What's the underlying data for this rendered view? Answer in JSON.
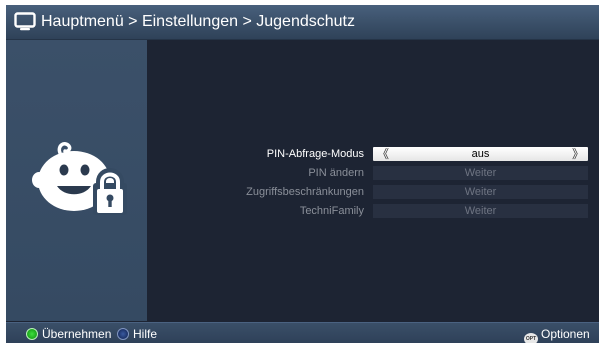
{
  "header": {
    "breadcrumb": "Hauptmenü > Einstellungen > Jugendschutz",
    "icon": "tv-icon"
  },
  "side_panel": {
    "icon": "child-lock-icon"
  },
  "menu": {
    "items": [
      {
        "label": "PIN-Abfrage-Modus",
        "value": "aus",
        "state": "active"
      },
      {
        "label": "PIN ändern",
        "value": "Weiter",
        "state": "disabled"
      },
      {
        "label": "Zugriffsbeschränkungen",
        "value": "Weiter",
        "state": "disabled"
      },
      {
        "label": "TechniFamily",
        "value": "Weiter",
        "state": "disabled"
      }
    ],
    "arrow_left": "《",
    "arrow_right": "》"
  },
  "footer": {
    "green_label": "Übernehmen",
    "blue_label": "Hilfe",
    "opt_badge": "OPT",
    "options_label": "Optionen"
  },
  "colors": {
    "background": "#1d2433",
    "header": "#3a4f68",
    "side_panel": "#3b5069",
    "green_key": "#1ab01a",
    "blue_key": "#1d3470"
  }
}
